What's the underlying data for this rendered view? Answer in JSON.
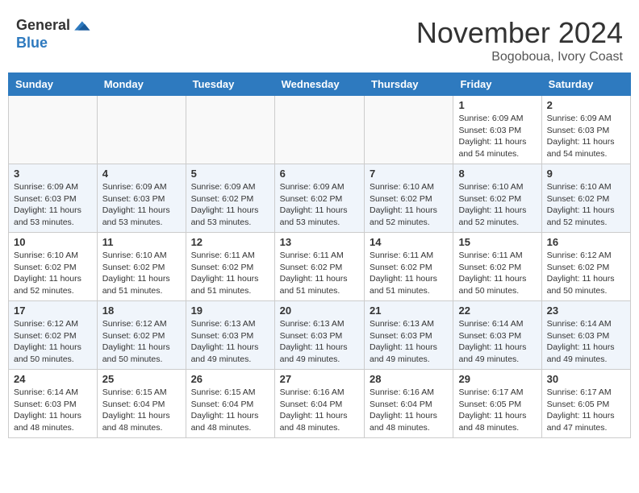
{
  "header": {
    "logo_general": "General",
    "logo_blue": "Blue",
    "month": "November 2024",
    "location": "Bogoboua, Ivory Coast"
  },
  "weekdays": [
    "Sunday",
    "Monday",
    "Tuesday",
    "Wednesday",
    "Thursday",
    "Friday",
    "Saturday"
  ],
  "weeks": [
    [
      {
        "day": "",
        "info": ""
      },
      {
        "day": "",
        "info": ""
      },
      {
        "day": "",
        "info": ""
      },
      {
        "day": "",
        "info": ""
      },
      {
        "day": "",
        "info": ""
      },
      {
        "day": "1",
        "info": "Sunrise: 6:09 AM\nSunset: 6:03 PM\nDaylight: 11 hours\nand 54 minutes."
      },
      {
        "day": "2",
        "info": "Sunrise: 6:09 AM\nSunset: 6:03 PM\nDaylight: 11 hours\nand 54 minutes."
      }
    ],
    [
      {
        "day": "3",
        "info": "Sunrise: 6:09 AM\nSunset: 6:03 PM\nDaylight: 11 hours\nand 53 minutes."
      },
      {
        "day": "4",
        "info": "Sunrise: 6:09 AM\nSunset: 6:03 PM\nDaylight: 11 hours\nand 53 minutes."
      },
      {
        "day": "5",
        "info": "Sunrise: 6:09 AM\nSunset: 6:02 PM\nDaylight: 11 hours\nand 53 minutes."
      },
      {
        "day": "6",
        "info": "Sunrise: 6:09 AM\nSunset: 6:02 PM\nDaylight: 11 hours\nand 53 minutes."
      },
      {
        "day": "7",
        "info": "Sunrise: 6:10 AM\nSunset: 6:02 PM\nDaylight: 11 hours\nand 52 minutes."
      },
      {
        "day": "8",
        "info": "Sunrise: 6:10 AM\nSunset: 6:02 PM\nDaylight: 11 hours\nand 52 minutes."
      },
      {
        "day": "9",
        "info": "Sunrise: 6:10 AM\nSunset: 6:02 PM\nDaylight: 11 hours\nand 52 minutes."
      }
    ],
    [
      {
        "day": "10",
        "info": "Sunrise: 6:10 AM\nSunset: 6:02 PM\nDaylight: 11 hours\nand 52 minutes."
      },
      {
        "day": "11",
        "info": "Sunrise: 6:10 AM\nSunset: 6:02 PM\nDaylight: 11 hours\nand 51 minutes."
      },
      {
        "day": "12",
        "info": "Sunrise: 6:11 AM\nSunset: 6:02 PM\nDaylight: 11 hours\nand 51 minutes."
      },
      {
        "day": "13",
        "info": "Sunrise: 6:11 AM\nSunset: 6:02 PM\nDaylight: 11 hours\nand 51 minutes."
      },
      {
        "day": "14",
        "info": "Sunrise: 6:11 AM\nSunset: 6:02 PM\nDaylight: 11 hours\nand 51 minutes."
      },
      {
        "day": "15",
        "info": "Sunrise: 6:11 AM\nSunset: 6:02 PM\nDaylight: 11 hours\nand 50 minutes."
      },
      {
        "day": "16",
        "info": "Sunrise: 6:12 AM\nSunset: 6:02 PM\nDaylight: 11 hours\nand 50 minutes."
      }
    ],
    [
      {
        "day": "17",
        "info": "Sunrise: 6:12 AM\nSunset: 6:02 PM\nDaylight: 11 hours\nand 50 minutes."
      },
      {
        "day": "18",
        "info": "Sunrise: 6:12 AM\nSunset: 6:02 PM\nDaylight: 11 hours\nand 50 minutes."
      },
      {
        "day": "19",
        "info": "Sunrise: 6:13 AM\nSunset: 6:03 PM\nDaylight: 11 hours\nand 49 minutes."
      },
      {
        "day": "20",
        "info": "Sunrise: 6:13 AM\nSunset: 6:03 PM\nDaylight: 11 hours\nand 49 minutes."
      },
      {
        "day": "21",
        "info": "Sunrise: 6:13 AM\nSunset: 6:03 PM\nDaylight: 11 hours\nand 49 minutes."
      },
      {
        "day": "22",
        "info": "Sunrise: 6:14 AM\nSunset: 6:03 PM\nDaylight: 11 hours\nand 49 minutes."
      },
      {
        "day": "23",
        "info": "Sunrise: 6:14 AM\nSunset: 6:03 PM\nDaylight: 11 hours\nand 49 minutes."
      }
    ],
    [
      {
        "day": "24",
        "info": "Sunrise: 6:14 AM\nSunset: 6:03 PM\nDaylight: 11 hours\nand 48 minutes."
      },
      {
        "day": "25",
        "info": "Sunrise: 6:15 AM\nSunset: 6:04 PM\nDaylight: 11 hours\nand 48 minutes."
      },
      {
        "day": "26",
        "info": "Sunrise: 6:15 AM\nSunset: 6:04 PM\nDaylight: 11 hours\nand 48 minutes."
      },
      {
        "day": "27",
        "info": "Sunrise: 6:16 AM\nSunset: 6:04 PM\nDaylight: 11 hours\nand 48 minutes."
      },
      {
        "day": "28",
        "info": "Sunrise: 6:16 AM\nSunset: 6:04 PM\nDaylight: 11 hours\nand 48 minutes."
      },
      {
        "day": "29",
        "info": "Sunrise: 6:17 AM\nSunset: 6:05 PM\nDaylight: 11 hours\nand 48 minutes."
      },
      {
        "day": "30",
        "info": "Sunrise: 6:17 AM\nSunset: 6:05 PM\nDaylight: 11 hours\nand 47 minutes."
      }
    ]
  ]
}
